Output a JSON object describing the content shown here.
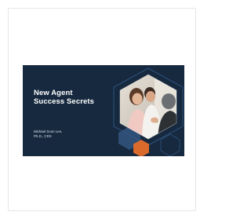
{
  "presentation": {
    "title_lines": [
      "New Agent",
      "Success Secrets"
    ],
    "author_lines": [
      "Michael Soon Lee,",
      "Ph.D., CRS"
    ]
  },
  "colors": {
    "slide_background": "#16293f",
    "hexagon_outline": "#2f527c",
    "hexagon_fill_blue": "#3a5f8c",
    "accent_orange": "#d96a2b"
  }
}
